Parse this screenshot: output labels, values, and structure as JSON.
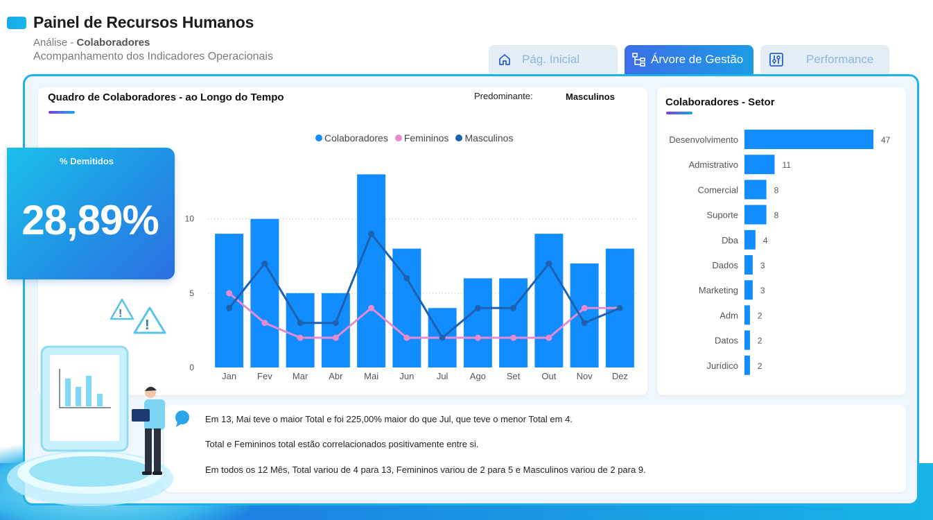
{
  "header": {
    "title": "Painel de Recursos Humanos",
    "subtitle_prefix": "Análise - ",
    "subtitle_bold": "Colaboradores",
    "subtitle2": "Acompanhamento dos Indicadores Operacionais"
  },
  "tabs": [
    {
      "label": "Pág. Inicial",
      "icon": "home-icon",
      "active": false
    },
    {
      "label": "Árvore de Gestão",
      "icon": "hierarchy-icon",
      "active": true
    },
    {
      "label": "Performance",
      "icon": "sliders-icon",
      "active": false
    }
  ],
  "kpi": {
    "label": "% Demitidos",
    "value": "28,89%"
  },
  "main_chart": {
    "title": "Quadro de Colaboradores - ao Longo do Tempo",
    "predominant_label": "Predominante:",
    "predominant_value": "Masculinos",
    "legend": [
      {
        "name": "Colaboradores",
        "color": "#118dff"
      },
      {
        "name": "Femininos",
        "color": "#e88ad0"
      },
      {
        "name": "Masculinos",
        "color": "#1c62b0"
      }
    ]
  },
  "sector_chart": {
    "title": "Colaboradores - Setor"
  },
  "insights": [
    "Em 13, Mai teve o maior Total e foi 225,00% maior do que Jul, que teve o menor Total em 4.",
    "Total e Femininos total estão correlacionados positivamente entre si.",
    "Em todos os 12 Mês, Total variou de 4 para 13, Femininos variou de 2 para 5 e Masculinos variou de 2 para 9."
  ],
  "chart_data": [
    {
      "type": "bar",
      "categories": [
        "Jan",
        "Fev",
        "Mar",
        "Abr",
        "Mai",
        "Jun",
        "Jul",
        "Ago",
        "Set",
        "Out",
        "Nov",
        "Dez"
      ],
      "series": [
        {
          "name": "Colaboradores",
          "kind": "bar",
          "color": "#118dff",
          "values": [
            9,
            10,
            5,
            5,
            13,
            8,
            4,
            6,
            6,
            9,
            7,
            8
          ]
        },
        {
          "name": "Femininos",
          "kind": "line",
          "color": "#e88ad0",
          "values": [
            5,
            3,
            2,
            2,
            4,
            2,
            2,
            2,
            2,
            2,
            4,
            4
          ]
        },
        {
          "name": "Masculinos",
          "kind": "line",
          "color": "#1c62b0",
          "values": [
            4,
            7,
            3,
            3,
            9,
            6,
            2,
            4,
            4,
            7,
            3,
            4
          ]
        }
      ],
      "yticks": [
        0,
        5,
        10
      ],
      "ylim": [
        0,
        14
      ],
      "grid": true,
      "legend_position": "top-center"
    },
    {
      "type": "bar",
      "orientation": "horizontal",
      "title": "Colaboradores - Setor",
      "categories": [
        "Desenvolvimento",
        "Admistrativo",
        "Comercial",
        "Suporte",
        "Dba",
        "Dados",
        "Marketing",
        "Adm",
        "Datos",
        "Jurídico"
      ],
      "values": [
        47,
        11,
        8,
        8,
        4,
        3,
        3,
        2,
        2,
        2
      ],
      "color": "#118dff"
    }
  ]
}
